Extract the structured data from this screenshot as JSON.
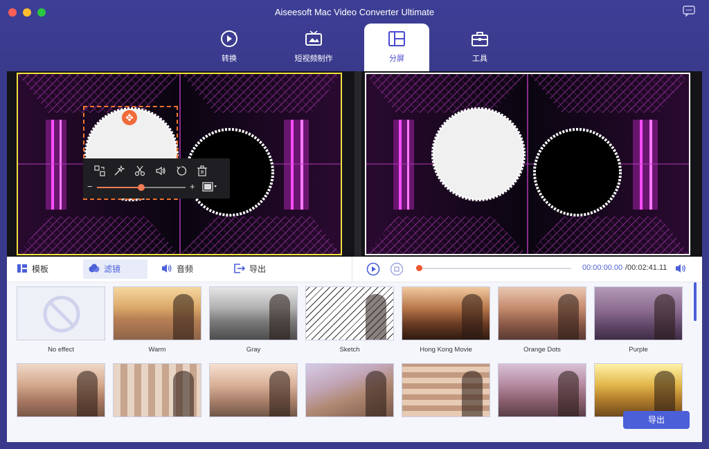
{
  "window": {
    "title": "Aiseesoft Mac Video Converter Ultimate"
  },
  "nav": [
    {
      "label": "转换",
      "icon": "convert-icon"
    },
    {
      "label": "短视频制作",
      "icon": "tv-icon"
    },
    {
      "label": "分屏",
      "icon": "split-screen-icon",
      "active": true
    },
    {
      "label": "工具",
      "icon": "toolbox-icon"
    }
  ],
  "editor": {
    "tools": [
      "swap-icon",
      "magic-wand-icon",
      "scissors-icon",
      "volume-icon",
      "rotate-icon",
      "trash-icon"
    ],
    "volume_level": 0.5
  },
  "lower_tabs": [
    {
      "label": "模板",
      "icon": "template-icon"
    },
    {
      "label": "滤镜",
      "icon": "filter-icon",
      "active": true
    },
    {
      "label": "音频",
      "icon": "audio-icon"
    },
    {
      "label": "导出",
      "icon": "export-icon"
    }
  ],
  "player": {
    "current_time": "00:00:00.00",
    "total_time": "/00:02:41.11",
    "progress": 0
  },
  "filters": [
    {
      "label": "No effect"
    },
    {
      "label": "Warm"
    },
    {
      "label": "Gray"
    },
    {
      "label": "Sketch"
    },
    {
      "label": "Hong Kong Movie"
    },
    {
      "label": "Orange Dots"
    },
    {
      "label": "Purple"
    },
    {
      "label": ""
    },
    {
      "label": ""
    },
    {
      "label": ""
    },
    {
      "label": ""
    },
    {
      "label": ""
    },
    {
      "label": ""
    },
    {
      "label": ""
    }
  ],
  "export_button": "导出",
  "colors": {
    "accent": "#4b5fd8",
    "header": "#3a3a8c",
    "selection": "#f0732e",
    "frame": "#f2e23c"
  }
}
